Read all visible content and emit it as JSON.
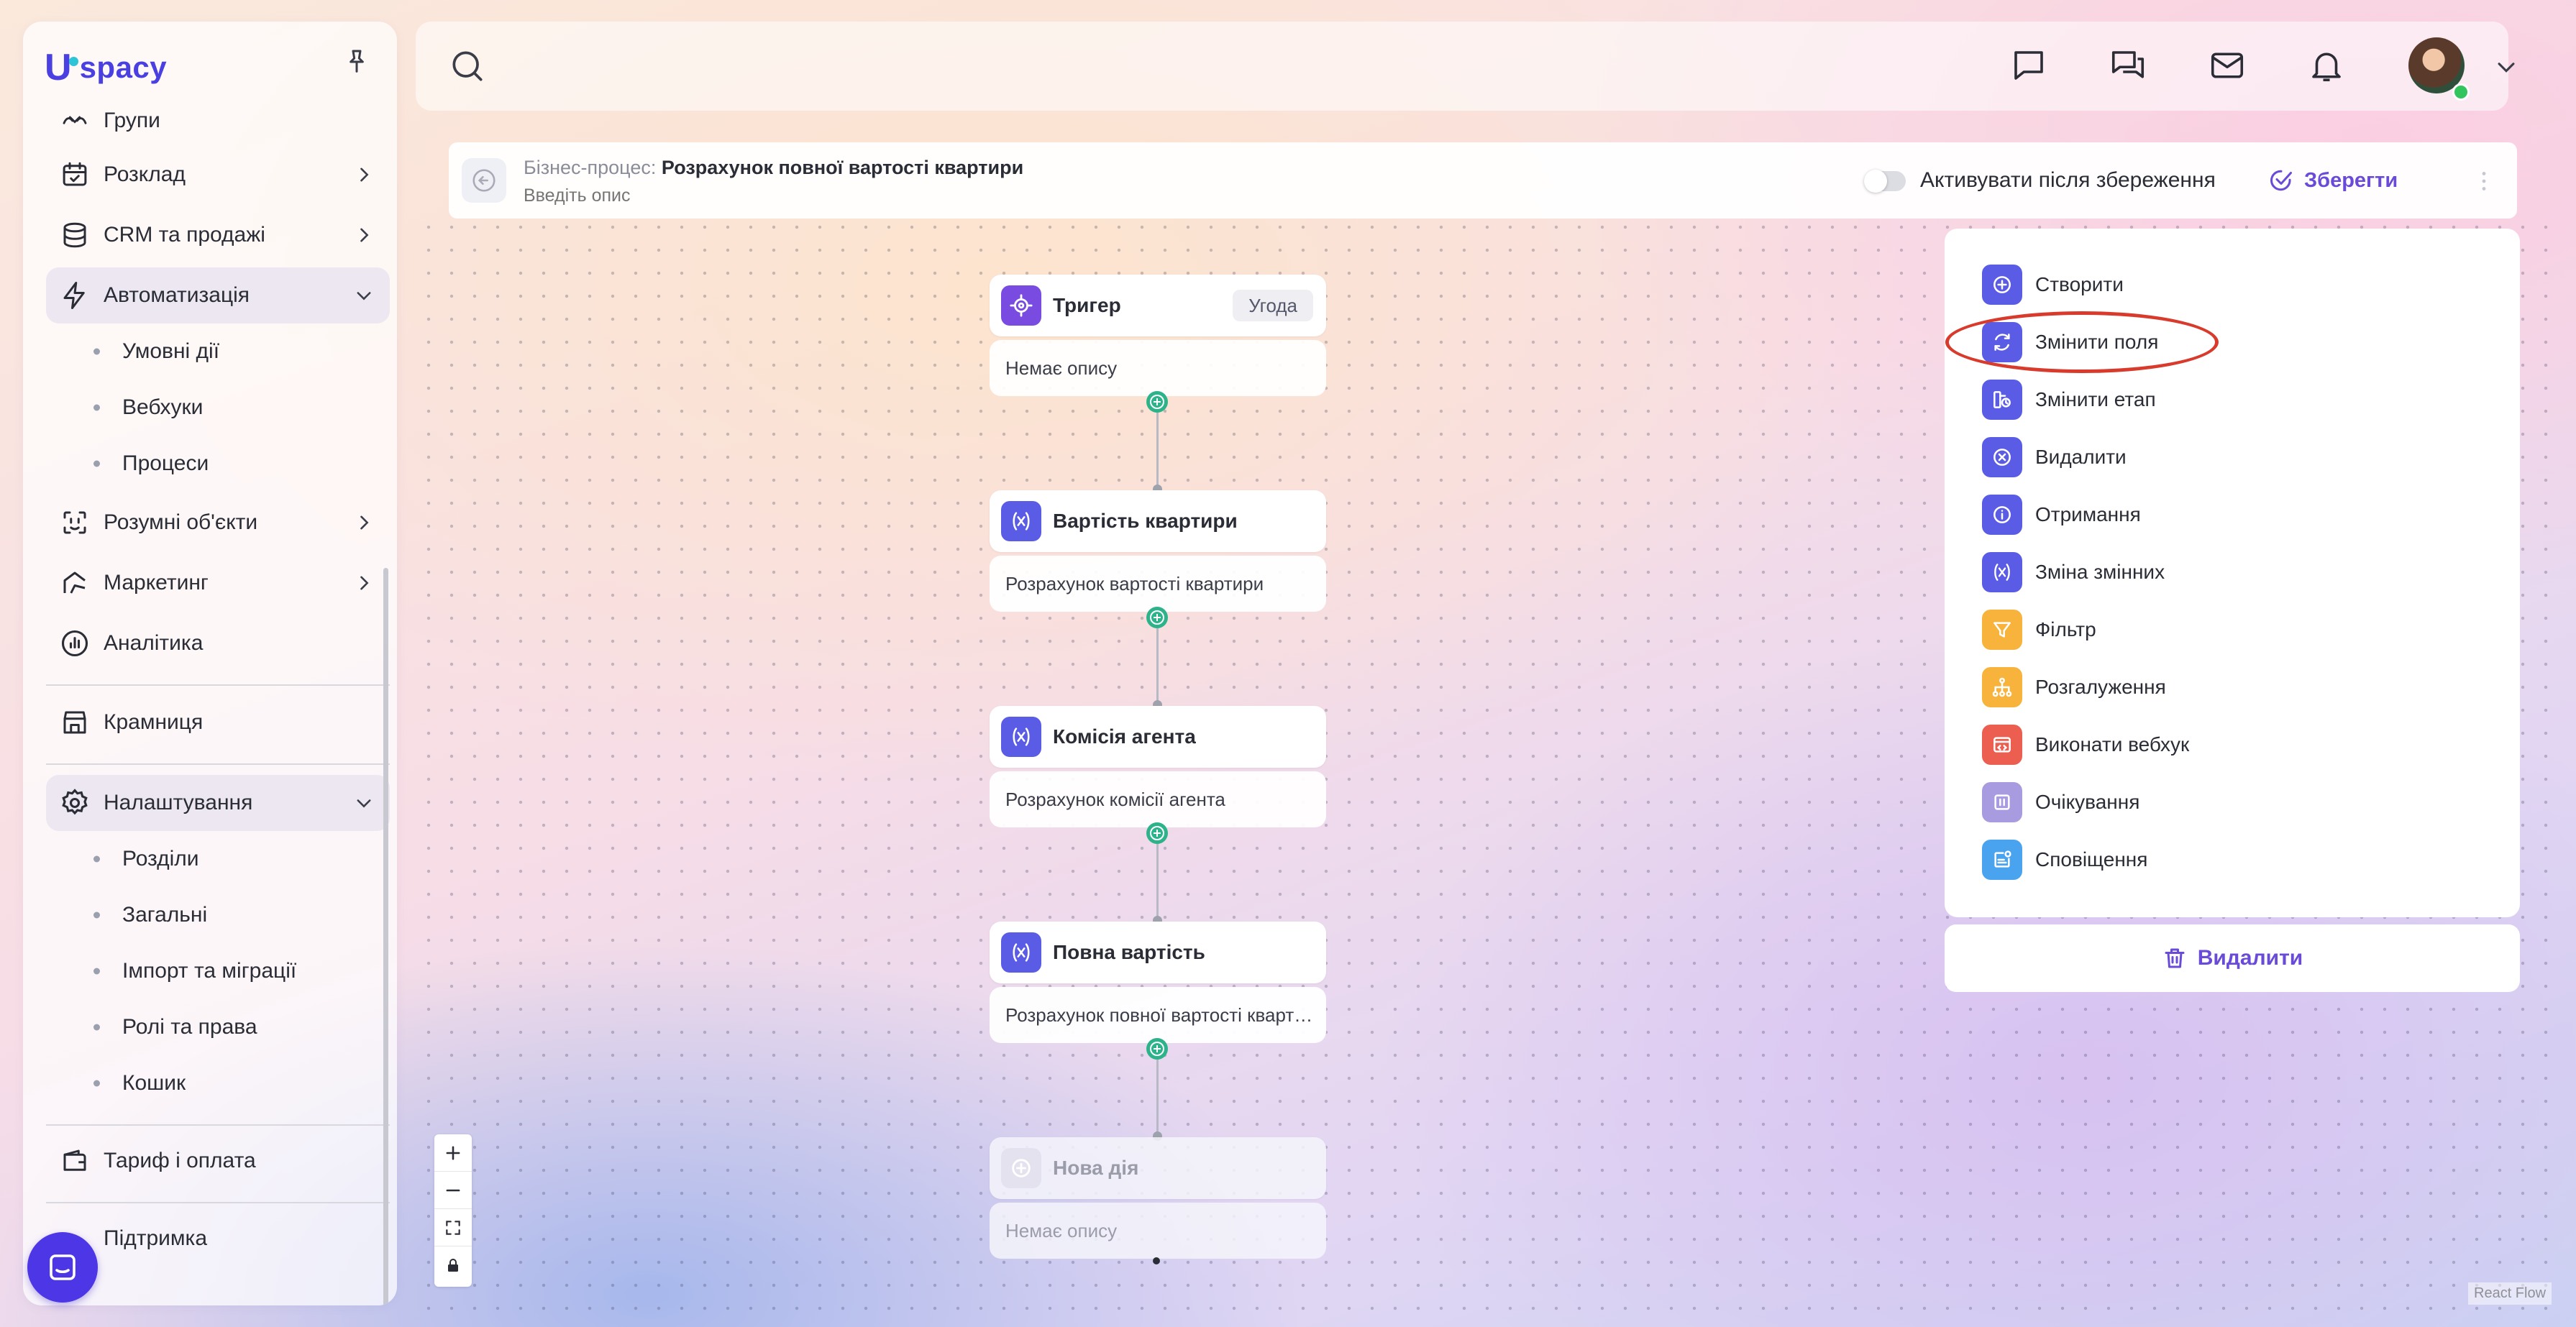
{
  "sidebar": {
    "logo_u": "U",
    "logo_text": "spacy",
    "items": [
      {
        "label": "Групи"
      },
      {
        "label": "Розклад"
      },
      {
        "label": "CRM та продажі"
      },
      {
        "label": "Автоматизація"
      },
      {
        "label": "Розумні об'єкти"
      },
      {
        "label": "Маркетинг"
      },
      {
        "label": "Аналітика"
      },
      {
        "label": "Крамниця"
      },
      {
        "label": "Налаштування"
      },
      {
        "label": "Тариф і оплата"
      },
      {
        "label": "Підтримка"
      }
    ],
    "automation_sub": [
      "Умовні дії",
      "Вебхуки",
      "Процеси"
    ],
    "settings_sub": [
      "Розділи",
      "Загальні",
      "Імпорт та міграції",
      "Ролі та права",
      "Кошик"
    ]
  },
  "topbar": {
    "search_placeholder": ""
  },
  "process": {
    "prefix": "Бізнес-процес:",
    "title": "Розрахунок повної вартості квартири",
    "description_placeholder": "Введіть опис",
    "activate_label": "Активувати після збереження",
    "activate_on": false,
    "save_label": "Зберегти"
  },
  "flow": {
    "nodes": [
      {
        "title": "Тригер",
        "badge": "Угода",
        "description": "Немає опису"
      },
      {
        "title": "Вартість квартири",
        "description": "Розрахунок вартості квартири"
      },
      {
        "title": "Комісія агента",
        "description": "Розрахунок комісії агента"
      },
      {
        "title": "Повна вартість",
        "description": "Розрахунок повної вартості квартири"
      },
      {
        "title": "Нова дія",
        "description": "Немає опису"
      }
    ],
    "attribution": "React Flow"
  },
  "actions": {
    "items": [
      {
        "label": "Створити",
        "color": "#5b5ce6",
        "icon": "plus-circle-icon"
      },
      {
        "label": "Змінити поля",
        "color": "#5b5ce6",
        "icon": "refresh-icon"
      },
      {
        "label": "Змінити етап",
        "color": "#5b5ce6",
        "icon": "stage-icon"
      },
      {
        "label": "Видалити",
        "color": "#5b5ce6",
        "icon": "x-circle-icon"
      },
      {
        "label": "Отримання",
        "color": "#5b5ce6",
        "icon": "info-icon"
      },
      {
        "label": "Зміна змінних",
        "color": "#5b5ce6",
        "icon": "variable-icon"
      },
      {
        "label": "Фільтр",
        "color": "#f7b33b",
        "icon": "filter-icon"
      },
      {
        "label": "Розгалуження",
        "color": "#f7b33b",
        "icon": "branch-icon"
      },
      {
        "label": "Виконати вебхук",
        "color": "#ec5e4f",
        "icon": "webhook-icon"
      },
      {
        "label": "Очікування",
        "color": "#a99be0",
        "icon": "pause-icon"
      },
      {
        "label": "Сповіщення",
        "color": "#4aa3ee",
        "icon": "notification-icon"
      }
    ],
    "highlighted": "Змінити поля",
    "delete_label": "Видалити"
  },
  "colors": {
    "accent": "#6a4bd8",
    "trigger": "#7a4be0",
    "step": "#5b5ce6",
    "handle": "#2db38a",
    "highlight": "#d83a2c"
  }
}
